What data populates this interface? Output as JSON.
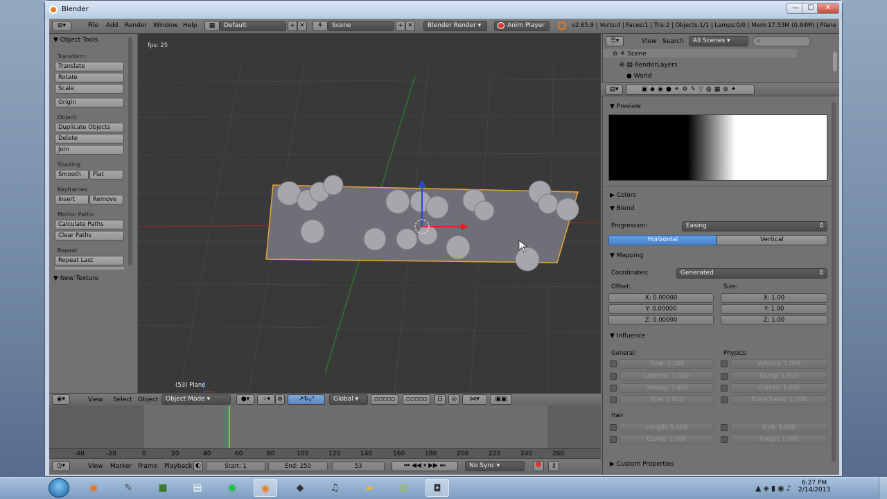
{
  "window": {
    "title": "Blender",
    "min": "—",
    "max": "☐",
    "close": "✕"
  },
  "infobar": {
    "menus": [
      "File",
      "Add",
      "Render",
      "Window",
      "Help"
    ],
    "layout": "Default",
    "scene": "Scene",
    "engine": "Blender Render",
    "anim_player": "Anim Player",
    "stats": "v2.65.9 | Verts:4 | Faces:1 | Tris:2 | Objects:1/1 | Lamps:0/0 | Mem:17.53M (0.84M) | Plane"
  },
  "toolpanel": {
    "title": "Object Tools",
    "transform_label": "Transform:",
    "translate": "Translate",
    "rotate": "Rotate",
    "scale": "Scale",
    "origin": "Origin",
    "object_label": "Object:",
    "duplicate": "Duplicate Objects",
    "delete": "Delete",
    "join": "Join",
    "shading_label": "Shading:",
    "smooth": "Smooth",
    "flat": "Flat",
    "keyframes_label": "Keyframes:",
    "insert": "Insert",
    "remove": "Remove",
    "motion_label": "Motion Paths:",
    "calc_paths": "Calculate Paths",
    "clear_paths": "Clear Paths",
    "repeat_label": "Repeat:",
    "repeat_last": "Repeat Last",
    "new_texture": "New Texture"
  },
  "viewport": {
    "fps": "fps: 25",
    "object_info": "(53) Plane"
  },
  "viewheader": {
    "view": "View",
    "select": "Select",
    "object": "Object",
    "mode": "Object Mode",
    "orientation": "Global"
  },
  "timeline": {
    "ticks": [
      "-40",
      "-20",
      "0",
      "20",
      "40",
      "60",
      "80",
      "100",
      "120",
      "140",
      "160",
      "180",
      "200",
      "220",
      "240",
      "260"
    ],
    "current_frame_marker": 53,
    "view": "View",
    "marker": "Marker",
    "frame": "Frame",
    "playback": "Playback",
    "start": "Start: 1",
    "end": "End: 250",
    "current": "53",
    "sync": "No Sync"
  },
  "outliner": {
    "view": "View",
    "search": "Search",
    "scope": "All Scenes",
    "items": [
      "Scene",
      "RenderLayers",
      "World"
    ]
  },
  "props": {
    "preview": "Preview",
    "colors": "Colors",
    "blend": "Blend",
    "progression_label": "Progression:",
    "progression": "Easing",
    "horizontal": "Horizontal",
    "vertical": "Vertical",
    "mapping": "Mapping",
    "coordinates_label": "Coordinates:",
    "coordinates": "Generated",
    "offset_label": "Offset:",
    "size_label": "Size:",
    "offset": [
      "X: 0.00000",
      "Y: 0.00000",
      "Z: 0.00000"
    ],
    "size": [
      "X: 1.00",
      "Y: 1.00",
      "Z: 1.00"
    ],
    "influence": "Influence",
    "general_label": "General:",
    "physics_label": "Physics:",
    "general": [
      "Time: 1.000",
      "Lifetime: 1.000",
      "Density: 1.000",
      "Size: 1.000"
    ],
    "physics": [
      "Velocity: 1.000",
      "Damp: 1.000",
      "Gravity: 1.000",
      "Force Fields: 1.000"
    ],
    "hair_label": "Hair:",
    "hair_left": [
      "Length: 1.000",
      "Clump: 1.000"
    ],
    "hair_right": [
      "Kink: 1.000",
      "Rough: 1.000"
    ],
    "custom": "Custom Properties"
  },
  "taskbar": {
    "time": "6:27 PM",
    "date": "2/14/2013"
  },
  "colors": {
    "accent": "#4a8fd8",
    "orange": "#e9a23b",
    "viewport_bg": "#393939"
  }
}
